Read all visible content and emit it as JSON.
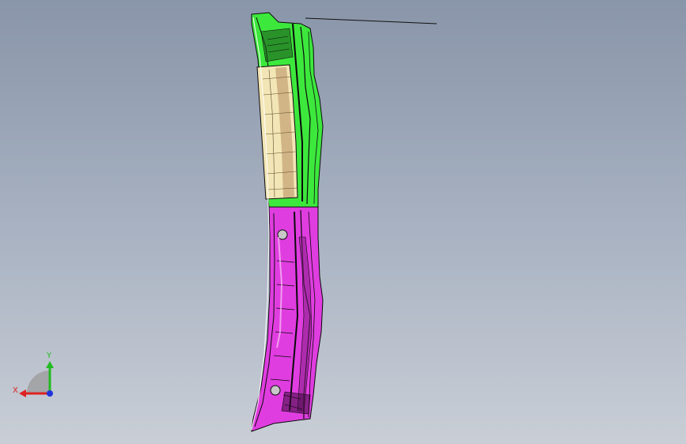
{
  "viewport": {
    "background_top": "#8995a9",
    "background_bottom": "#c9ced6"
  },
  "model": {
    "upper_part_color": "#33ee33",
    "lower_part_color": "#dd33dd",
    "insert_color": "#f2e6b8",
    "edge_color": "#0a0a0a"
  },
  "triad": {
    "x_label": "X",
    "y_label": "Y",
    "x_color": "#dd2222",
    "y_color": "#22bb22",
    "z_color": "#2233dd",
    "plane_color": "#9a9a9a"
  }
}
